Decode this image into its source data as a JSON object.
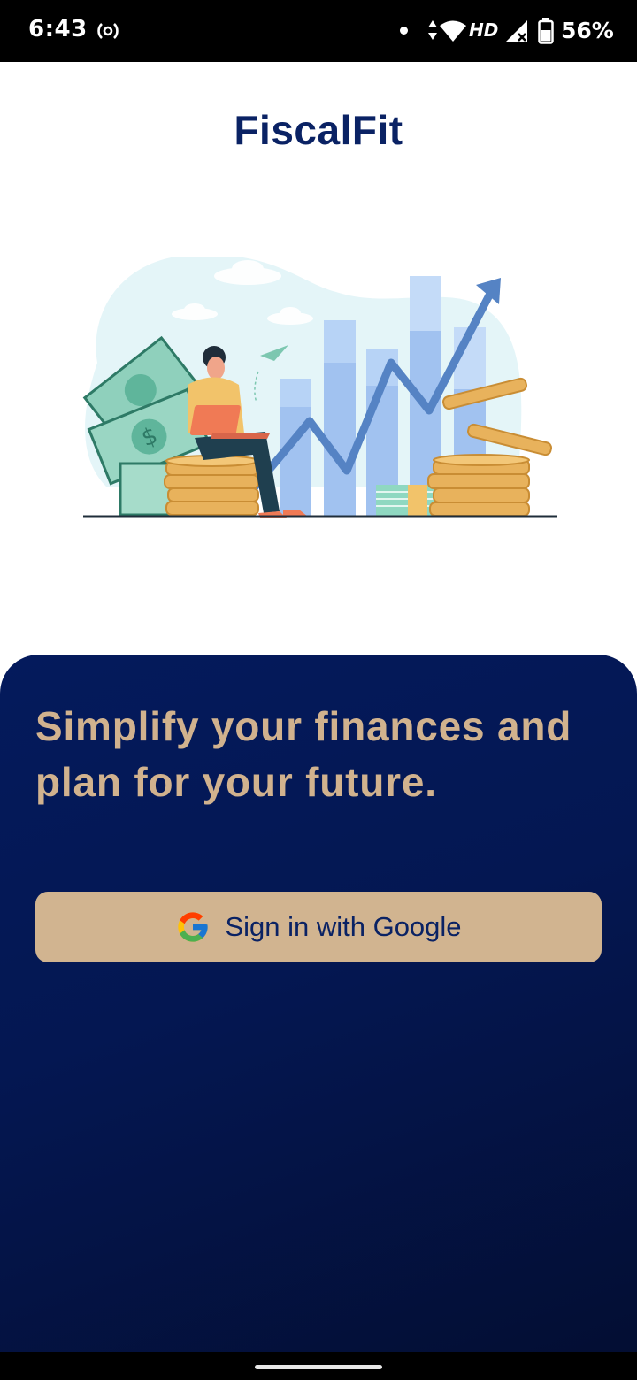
{
  "status_bar": {
    "time": "6:43",
    "network_label": "HD",
    "battery": "56%",
    "icons": [
      "radio-broadcast-icon",
      "notification-dot-icon",
      "data-arrows-icon",
      "wifi-icon",
      "signal-icon",
      "battery-icon"
    ]
  },
  "header": {
    "title": "FiscalFit",
    "title_color": "#0a2264"
  },
  "illustration": {
    "name": "finance-growth-illustration"
  },
  "panel": {
    "tagline": "Simplify your finances and plan for your future.",
    "tagline_color": "#d1b28e",
    "background_color": "#041a5c",
    "sign_in_button": {
      "label": "Sign in with Google",
      "icon": "google-g-icon",
      "background_color": "#d1b490",
      "text_color": "#0a2264"
    }
  }
}
